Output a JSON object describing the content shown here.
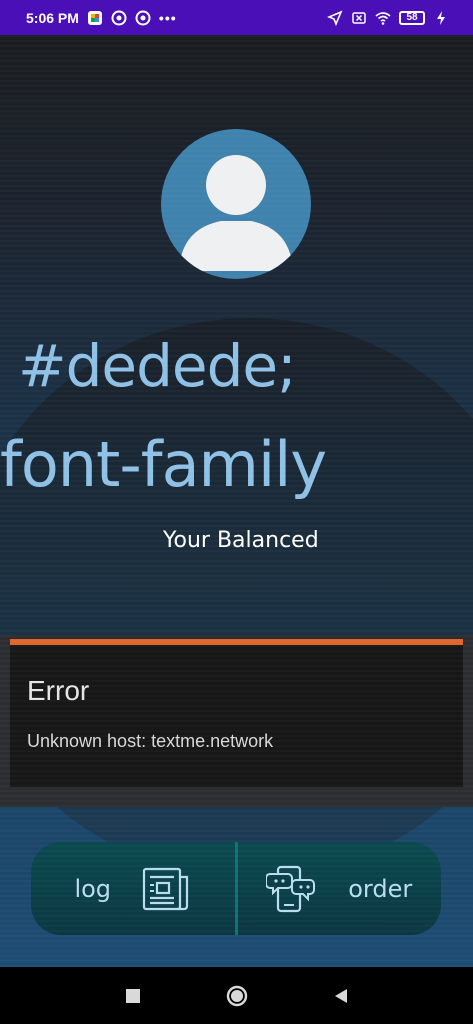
{
  "status_bar": {
    "time": "5:06 PM",
    "battery": "58",
    "icons": [
      "photos-icon",
      "sync-icon",
      "sync-icon",
      "more-icon",
      "location-icon",
      "no-sim-icon",
      "wifi-icon",
      "battery-icon",
      "charging-icon"
    ]
  },
  "profile": {
    "avatar_icon": "user-avatar-icon",
    "heading_line1": "#dedede;",
    "heading_line2": "font-family",
    "tagline": "Your Balanced"
  },
  "error": {
    "title": "Error",
    "message": "Unknown host: textme.network",
    "accent_color": "#e0642c"
  },
  "actions": {
    "log_label": "log",
    "log_icon": "newspaper-icon",
    "order_label": "order",
    "order_icon": "phone-chat-icon"
  },
  "nav": {
    "buttons": [
      "recents-square-icon",
      "home-circle-icon",
      "back-triangle-icon"
    ]
  },
  "colors": {
    "status_bar": "#4a0fb7",
    "heading_text": "#8fc1e6",
    "action_bg": "#0a4a4f"
  }
}
